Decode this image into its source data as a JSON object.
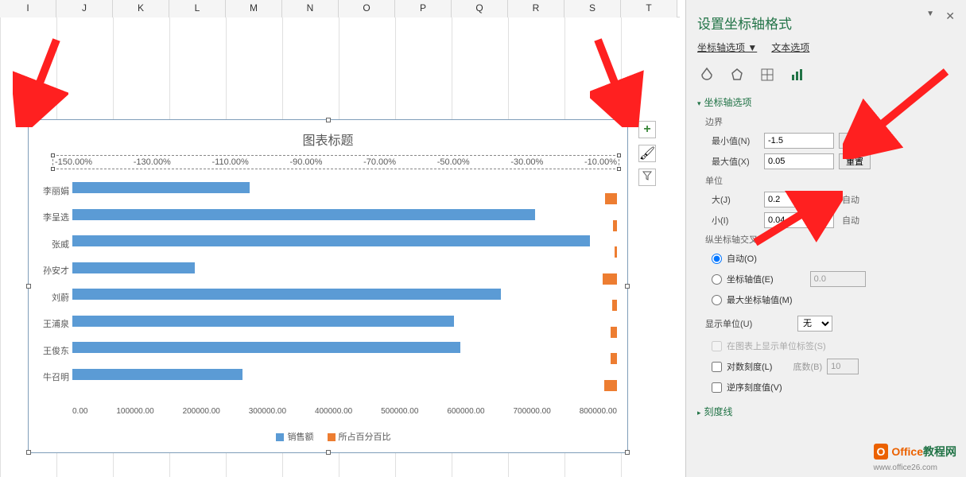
{
  "columns": [
    "I",
    "J",
    "K",
    "L",
    "M",
    "N",
    "O",
    "P",
    "Q",
    "R",
    "S",
    "T"
  ],
  "chart": {
    "title": "图表标题",
    "legend1": "销售额",
    "legend2": "所占百分百比",
    "topTicks": [
      "-150.00%",
      "-130.00%",
      "-110.00%",
      "-90.00%",
      "-70.00%",
      "-50.00%",
      "-30.00%",
      "-10.00%"
    ],
    "botTicks": [
      "0.00",
      "100000.00",
      "200000.00",
      "300000.00",
      "400000.00",
      "500000.00",
      "600000.00",
      "700000.00",
      "800000.00"
    ]
  },
  "chart_data": {
    "type": "bar",
    "title": "图表标题",
    "xlabel": "",
    "ylabel": "",
    "categories": [
      "李丽娟",
      "李呈选",
      "张威",
      "孙安才",
      "刘蔚",
      "王浦泉",
      "王俊东",
      "牛召明"
    ],
    "series": [
      {
        "name": "销售额",
        "values": [
          260000,
          680000,
          760000,
          180000,
          630000,
          560000,
          570000,
          250000
        ],
        "axis": "primary"
      },
      {
        "name": "所占百分百比",
        "values": [
          0.015,
          0.038,
          0.043,
          0.01,
          0.036,
          0.032,
          0.032,
          0.014
        ],
        "axis": "secondary"
      }
    ],
    "primary_axis": {
      "min": 0,
      "max": 800000
    },
    "secondary_axis": {
      "min": -1.5,
      "max": 0.05
    }
  },
  "pane": {
    "title": "设置坐标轴格式",
    "opt1": "坐标轴选项",
    "opt2": "文本选项",
    "section": "坐标轴选项",
    "bounds": "边界",
    "minLbl": "最小值(N)",
    "minVal": "-1.5",
    "reset": "重置",
    "maxLbl": "最大值(X)",
    "maxVal": "0.05",
    "unit": "单位",
    "majLbl": "大(J)",
    "majVal": "0.2",
    "auto": "自动",
    "minorLbl": "小(I)",
    "minorVal": "0.04",
    "cross": "纵坐标轴交叉",
    "r1": "自动(O)",
    "r2": "坐标轴值(E)",
    "r2val": "0.0",
    "r3": "最大坐标轴值(M)",
    "dispUnit": "显示单位(U)",
    "dispUnitVal": "无",
    "showLbl": "在图表上显示单位标签(S)",
    "log": "对数刻度(L)",
    "baseLbl": "底数(B)",
    "baseVal": "10",
    "rev": "逆序刻度值(V)",
    "ticks": "刻度线"
  },
  "logo": {
    "t1": "Office",
    "t2": "教程网",
    "url": "www.office26.com"
  }
}
